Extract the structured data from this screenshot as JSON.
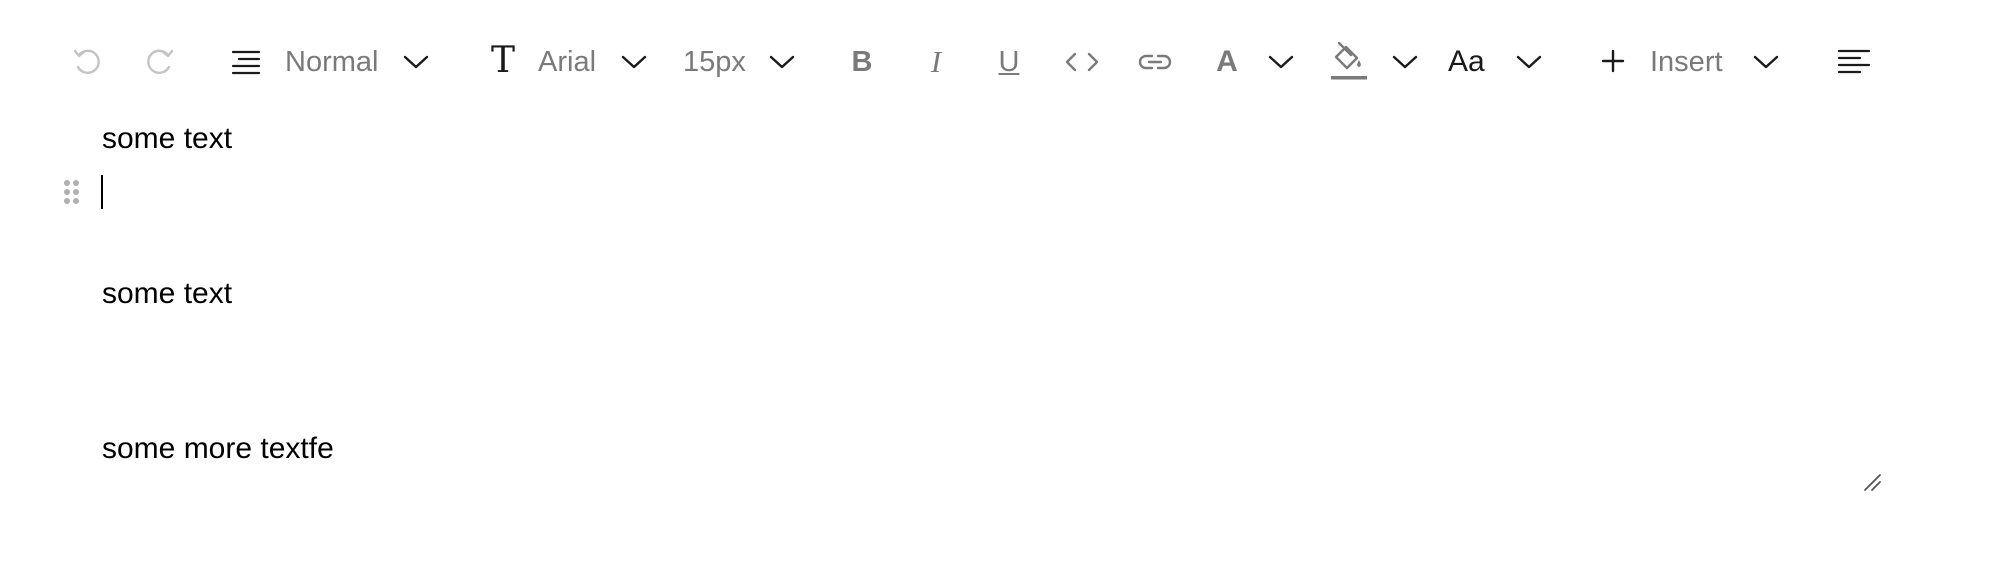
{
  "toolbar": {
    "undo_icon": "undo-icon",
    "redo_icon": "redo-icon",
    "block_type": {
      "icon": "paragraph-lines-icon",
      "label": "Normal"
    },
    "font_family": {
      "icon": "font-T-icon",
      "label": "Arial"
    },
    "font_size": {
      "label": "15px"
    },
    "bold": "B",
    "italic": "I",
    "underline": "U",
    "code_icon": "code-icon",
    "link_icon": "link-icon",
    "font_color": {
      "label": "A"
    },
    "bg_color_icon": "paint-bucket-icon",
    "text_case": {
      "label": "Aa"
    },
    "insert": {
      "icon": "plus-icon",
      "label": "Insert"
    },
    "align_icon": "align-left-icon"
  },
  "editor": {
    "paragraphs": [
      "some text",
      "",
      "",
      "some text",
      "",
      "",
      "some more textfe"
    ]
  },
  "colors": {
    "disabled_icon": "#c4c4c4",
    "icon": "#7a7a7a",
    "text": "#000000"
  }
}
